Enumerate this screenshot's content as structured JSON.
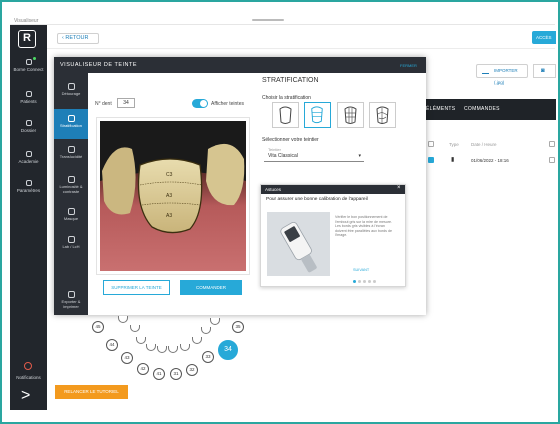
{
  "app": {
    "window_title": "Visualiseur",
    "logo_letter": "R"
  },
  "sidebar": {
    "items": [
      {
        "label": "Borne Connect"
      },
      {
        "label": "Patients"
      },
      {
        "label": "Dossier"
      },
      {
        "label": "Academie"
      },
      {
        "label": "Paramètres"
      }
    ],
    "notifications_label": "Notifications",
    "expand_glyph": ">"
  },
  "topbar": {
    "back_label": "RETOUR",
    "access_label": "ACCÈS"
  },
  "background_panel": {
    "import_label": "IMPORTER (.jpg)",
    "tabs": [
      "ÉLÉMENTS",
      "COMMANDES"
    ],
    "table_headers": [
      "Type",
      "Date / Heure"
    ],
    "rows": [
      {
        "checked": true,
        "date": "01/06/2022 - 18:16"
      }
    ]
  },
  "modal": {
    "title": "VISUALISEUR DE TEINTE",
    "close_label": "FERMER",
    "side_items": [
      {
        "label": "Détourage",
        "active": false
      },
      {
        "label": "Stratification",
        "active": true
      },
      {
        "label": "Translucidité",
        "active": false
      },
      {
        "label": "Luminosité & contraste",
        "active": false
      },
      {
        "label": "Masque",
        "active": false
      },
      {
        "label": "Lab / LcH",
        "active": false
      },
      {
        "label": "Exporter & imprimer",
        "active": false
      }
    ],
    "tooth_number_label": "N° dent",
    "tooth_number_value": "34",
    "show_shades_label": "Afficher teintes",
    "show_shades_on": true,
    "delete_shade_label": "SUPPRIMER LA TEINTE",
    "order_label": "COMMANDER",
    "stratification": {
      "title": "STRATIFICATION",
      "choose_label": "Choisir la stratification",
      "options": [
        "simple",
        "3 zones",
        "9 zones",
        "personnalisée"
      ],
      "selected_index": 1,
      "shades_label": "Sélectionner votre teintier",
      "shade_guide_label": "Teintier",
      "shade_guide_value": "Vita Classical"
    },
    "photo_labels": [
      "C3",
      "A3",
      "A3"
    ],
    "popup": {
      "header": "Astuces",
      "message": "Pour assurer une bonne calibration de l'appareil",
      "body": "Vérifier le bon positionnement de l'embout gris sur la mire de mesure. Les bords gris visibles à l'écran doivent être parallèles aux bords de l'image.",
      "next_label": "SUIVANT",
      "page_count": 5,
      "current_page": 1
    }
  },
  "odontogram": {
    "left_teeth": [
      "45",
      "44",
      "43",
      "42",
      "41"
    ],
    "right_teeth": [
      "31",
      "32",
      "33",
      "35"
    ],
    "selected_tooth": "34"
  },
  "tutorial_button_label": "RELANCER LE TUTORIEL",
  "colors": {
    "accent": "#27a9d8",
    "dark": "#2b2f36",
    "orange": "#f39a1e",
    "frame": "#2aa6a0"
  }
}
